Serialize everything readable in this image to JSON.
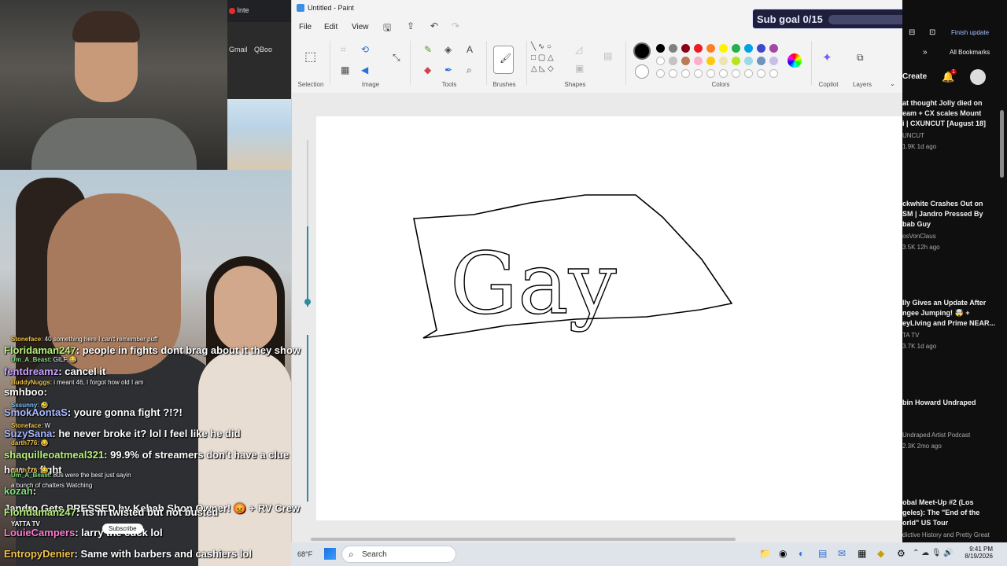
{
  "browser": {
    "tab_partial": "Inte",
    "bookmarks": [
      "Gmail",
      "QBoo"
    ]
  },
  "paint": {
    "title": "Untitled - Paint",
    "menu": [
      "File",
      "Edit",
      "View"
    ],
    "groups": [
      "Selection",
      "Image",
      "Tools",
      "Brushes",
      "Shapes",
      "Colors",
      "Copilot",
      "Layers"
    ],
    "canvas_text": "Gay",
    "palette": [
      "#000000",
      "#7f7f7f",
      "#880015",
      "#ed1c24",
      "#ff7f27",
      "#fff200",
      "#22b14c",
      "#00a2e8",
      "#3f48cc",
      "#a349a4",
      "#ffffff",
      "#c3c3c3",
      "#b97a57",
      "#ffaec9",
      "#ffc90e",
      "#efe4b0",
      "#b5e61d",
      "#99d9ea",
      "#7092be",
      "#c8bfe7"
    ]
  },
  "subgoal": {
    "label": "Sub goal 0/15",
    "progress": 0
  },
  "youtube": {
    "top": {
      "finish_update": "Finish update",
      "all_bookmarks": "All Bookmarks",
      "create": "Create",
      "notif": "1"
    },
    "videos": [
      {
        "t1": "at thought Jolly died on",
        "t2": "eam + CX scales Mount",
        "t3": "i | CXUNCUT [August 18]",
        "ch": "UNCUT",
        "meta": "1.9K  1d ago"
      },
      {
        "t1": "ckwhite Crashes Out on",
        "t2": "SM | Jandro Pressed By",
        "t3": "bab Guy",
        "ch": "osVonClaus",
        "meta": "3.5K  12h ago"
      },
      {
        "t1": "lly Gives an Update After",
        "t2": "ngee Jumping! 🤯 +",
        "t3": "eyLiving and Prime NEAR...",
        "ch": "TA TV",
        "meta": "3.7K  1d ago"
      },
      {
        "t1": "bin Howard Undraped",
        "t2": "",
        "t3": "",
        "ch": "Undraped Artist Podcast",
        "meta": "2.3K  2mo ago"
      },
      {
        "t1": "obal Meet-Up #2 (Los",
        "t2": "geles): The \"End of the",
        "t3": "orld\" US Tour",
        "ch": "dictive History and Pretty Great",
        "meta": ""
      }
    ]
  },
  "chat": {
    "lines": [
      {
        "user": "Stoneface",
        "msg": ": 40 something here I can't remember puff",
        "size": "small",
        "color": "#f0c24a"
      },
      {
        "user": "Floridaman247",
        "msg": ": people in fights dont brag about it they show",
        "size": "big",
        "color": "#b6f27a"
      },
      {
        "user": "Um_A_Beast",
        "msg": ": GILF 😂",
        "size": "small",
        "color": "#7ee07e"
      },
      {
        "user": "fentdreamz",
        "msg": ": cancel it",
        "size": "big",
        "color": "#c9a1ff"
      },
      {
        "user": "BuddyNuggs",
        "msg": ": i meant 46, I forgot how old I am",
        "size": "small",
        "color": "#f0c24a"
      },
      {
        "user": "smhboo",
        "msg": ":",
        "size": "big",
        "color": "#ffffff"
      },
      {
        "user": "Sssunny",
        "msg": ": 🤣",
        "size": "small",
        "color": "#7ec8ff"
      },
      {
        "user": "SmokAontaS",
        "msg": ": youre gonna fight ?!?!",
        "size": "big",
        "color": "#a9b8ff"
      },
      {
        "user": "Stoneface",
        "msg": ": W",
        "size": "small",
        "color": "#f0c24a"
      },
      {
        "user": "SuzySana",
        "msg": ": he never broke it? lol I feel like he did",
        "size": "big",
        "color": "#a9b8ff"
      },
      {
        "user": "darth776",
        "msg": ": 😂",
        "size": "small",
        "color": "#f0c24a"
      },
      {
        "user": "shaquilleoatmeal321",
        "msg": ": 99.9% of streamers don't have a clue",
        "size": "big",
        "color": "#b6f27a"
      },
      {
        "user": "",
        "msg": "how to fight",
        "size": "big",
        "color": "#ffffff"
      },
      {
        "user": "darth776",
        "msg": ": 😂",
        "size": "small",
        "color": "#f0c24a"
      },
      {
        "user": "Um_A_Beast",
        "msg": ": 80s were the best just sayin",
        "size": "small",
        "color": "#7ee07e"
      },
      {
        "user": "",
        "msg": "a bunch of chatters Watching",
        "size": "small",
        "color": "#ffffff"
      },
      {
        "user": "kozah",
        "msg": ":",
        "size": "big",
        "color": "#7ee07e"
      },
      {
        "user": "",
        "msg": "Jandro Gets PRESSED by Kebab Shop Owner! 😡 + RV Crew",
        "size": "big",
        "color": "#ffffff"
      },
      {
        "user": "Floridaman247",
        "msg": ": its m twisted but not busted",
        "size": "big",
        "color": "#b6f27a"
      },
      {
        "user": "YATTA TV",
        "msg": "",
        "size": "small",
        "color": "#ffffff"
      },
      {
        "user": "LouieCampers",
        "msg": ": larry the cuck lol",
        "size": "big",
        "color": "#ff7ad1"
      },
      {
        "user": "EntropyDenier",
        "msg": ": Same with barbers and cashiers lol",
        "size": "big",
        "color": "#f0c24a"
      }
    ],
    "subscribe": "Subscribe",
    "weather": "68°F"
  },
  "taskbar": {
    "search": "Search",
    "time": "9:41 PM",
    "date": "8/19/2026"
  }
}
